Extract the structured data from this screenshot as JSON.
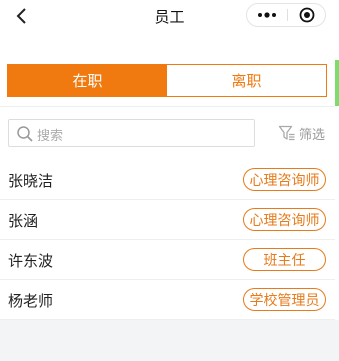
{
  "nav": {
    "title": "员工"
  },
  "tabs": [
    {
      "label": "在职",
      "active": true
    },
    {
      "label": "离职",
      "active": false
    }
  ],
  "search": {
    "placeholder": "搜索"
  },
  "filter": {
    "label": "筛选"
  },
  "employees": [
    {
      "name": "张晓洁",
      "role": "心理咨询师"
    },
    {
      "name": "张涵",
      "role": "心理咨询师"
    },
    {
      "name": "许东波",
      "role": "班主任"
    },
    {
      "name": "杨老师",
      "role": "学校管理员"
    }
  ],
  "colors": {
    "accent": "#f07a10",
    "background_bottom": "#f2f4f6"
  },
  "icons": {
    "back": "chevron-left-icon",
    "more": "more-dots-icon",
    "close": "target-close-icon",
    "search": "search-icon",
    "filter": "filter-icon"
  }
}
